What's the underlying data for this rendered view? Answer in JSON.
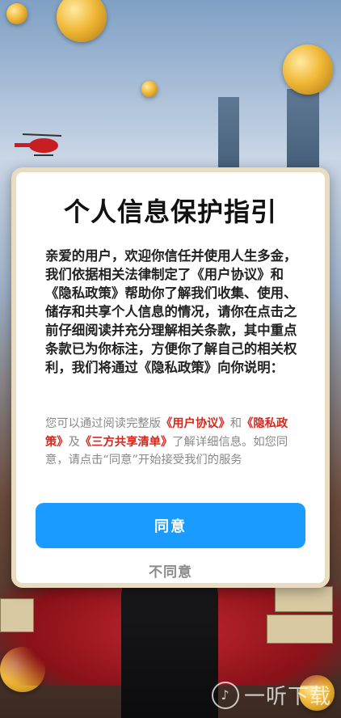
{
  "dialog": {
    "title": "个人信息保护指引",
    "body": "亲爱的用户，欢迎你信任并使用人生多金，我们依据相关法律制定了《用户协议》和《隐私政策》帮助你了解我们收集、使用、储存和共享个人信息的情况，请你在点击之前仔细阅读并充分理解相关条款，其中重点条款已为你标注，方便你了解自己的相关权利，我们将通过《隐私政策》向你说明：",
    "sub_prefix": "您可以通过阅读完整版",
    "link_user_agreement": "《用户协议》",
    "sub_and": "和",
    "link_privacy_policy": "《隐私政策》",
    "sub_also": "及",
    "link_third_party": "《三方共享清单》",
    "sub_suffix": "了解详细信息。如您同意，请点击“同意”开始接受我们的服务",
    "agree_label": "同意",
    "disagree_label": "不同意"
  },
  "watermark": {
    "icon": "ear-icon",
    "text": "一听下载"
  },
  "colors": {
    "agree_button": "#1a9bff",
    "link": "#d7281e",
    "dialog_border": "#e9dcc0"
  }
}
